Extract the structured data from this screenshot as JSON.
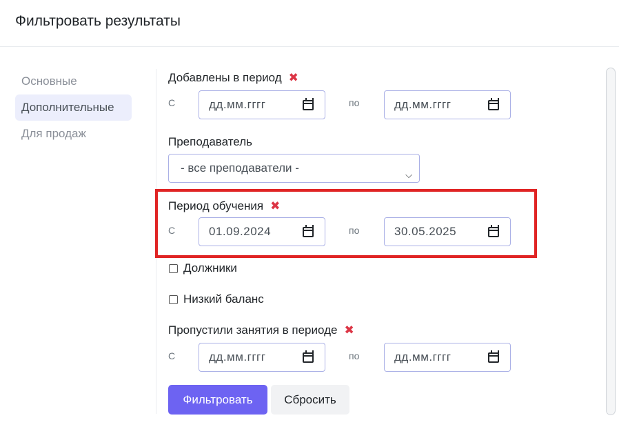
{
  "header": {
    "title": "Фильтровать результаты"
  },
  "nav": {
    "items": [
      {
        "label": "Основные"
      },
      {
        "label": "Дополнительные"
      },
      {
        "label": "Для продаж"
      }
    ]
  },
  "filters": {
    "added_period": {
      "label": "Добавлены в период",
      "from_label": "С",
      "to_label": "по",
      "from_value": "дд.мм.гггг",
      "to_value": "дд.мм.гггг"
    },
    "teacher": {
      "label": "Преподаватель",
      "selected": "- все преподаватели -"
    },
    "study_period": {
      "label": "Период обучения",
      "from_label": "С",
      "to_label": "по",
      "from_value": "01.09.2024",
      "to_value": "30.05.2025"
    },
    "debtors": {
      "label": "Должники",
      "checked": false
    },
    "low_balance": {
      "label": "Низкий баланс",
      "checked": false
    },
    "missed_period": {
      "label": "Пропустили занятия в периоде",
      "from_label": "С",
      "to_label": "по",
      "from_value": "дд.мм.гггг",
      "to_value": "дд.мм.гггг"
    }
  },
  "actions": {
    "filter_label": "Фильтровать",
    "reset_label": "Сбросить"
  },
  "icons": {
    "clear": "close-icon",
    "calendar": "calendar-icon",
    "dropdown": "chevron-down-icon"
  },
  "colors": {
    "primary": "#6d63f2",
    "clear_x": "#dc3545",
    "highlight_border": "#e02424",
    "active_nav_bg": "#eceefc"
  }
}
